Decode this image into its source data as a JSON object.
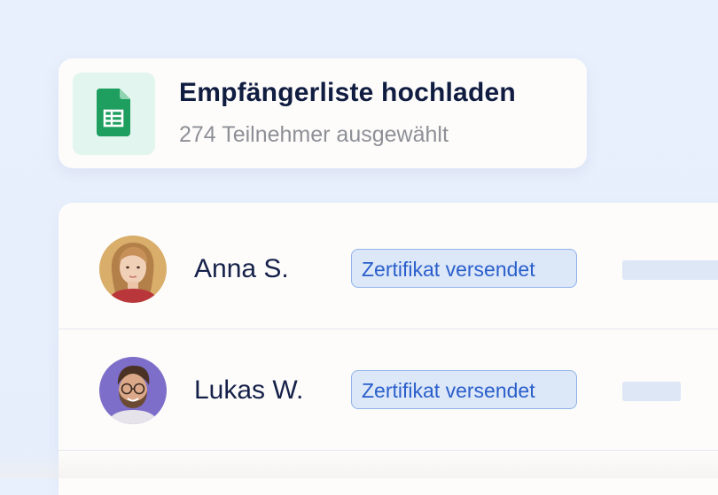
{
  "upload": {
    "title": "Empfängerliste hochladen",
    "subtitle": "274 Teilnehmer ausgewählt",
    "icon": "spreadsheet-icon",
    "icon_color": "#1e9e5f",
    "tile_color": "#e2f5ee"
  },
  "recipients": [
    {
      "name": "Anna S.",
      "status": "Zertifikat versendet",
      "avatar_bg": "#d9ae6a"
    },
    {
      "name": "Lukas W.",
      "status": "Zertifikat versendet",
      "avatar_bg": "#7d6fc9"
    }
  ],
  "colors": {
    "background": "#e9f0fd",
    "badge_text": "#2a5fcb",
    "badge_bg": "#dce7f8",
    "badge_border": "#8fb2ea",
    "name_text": "#16214a"
  }
}
